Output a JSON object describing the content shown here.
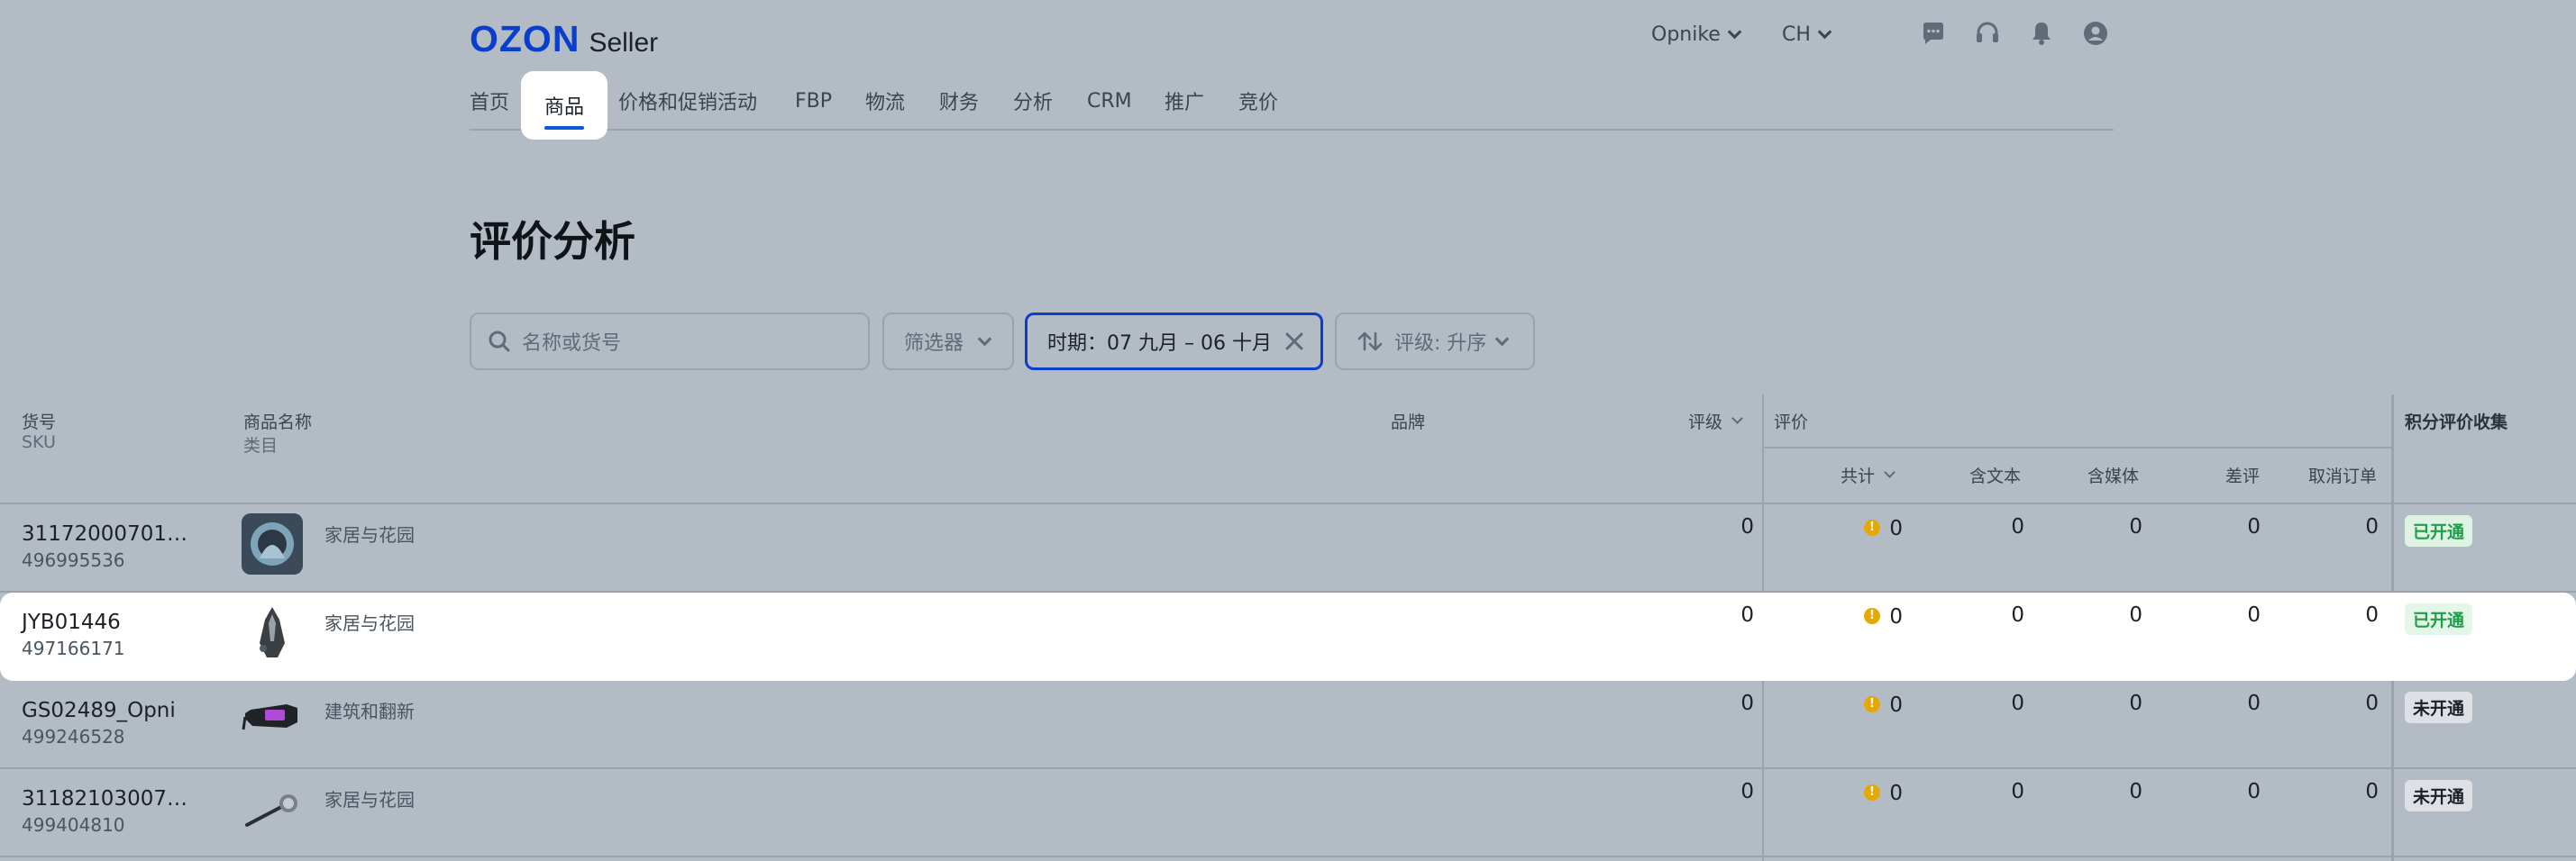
{
  "header": {
    "logo_brand": "OZON",
    "logo_product": "Seller",
    "account": "Opnike",
    "language": "CH",
    "icons": [
      "chat-icon",
      "headset-icon",
      "bell-icon",
      "user-icon"
    ]
  },
  "nav": {
    "items": [
      {
        "label": "首页"
      },
      {
        "label": "商品"
      },
      {
        "label": "价格和促销活动"
      },
      {
        "label": "FBP"
      },
      {
        "label": "物流"
      },
      {
        "label": "财务"
      },
      {
        "label": "分析"
      },
      {
        "label": "CRM"
      },
      {
        "label": "推广"
      },
      {
        "label": "竞价"
      }
    ],
    "active_index": 1
  },
  "page": {
    "title": "评价分析"
  },
  "filters": {
    "search_placeholder": "名称或货号",
    "filter_label": "筛选器",
    "period_label": "时期：07 九月 – 06 十月",
    "sort_label": "评级: 升序"
  },
  "table": {
    "headers": {
      "sku_top": "货号",
      "sku_bottom": "SKU",
      "name_top": "商品名称",
      "name_bottom": "类目",
      "brand": "品牌",
      "rating": "评级",
      "reviews": "评价",
      "total": "共计",
      "with_text": "含文本",
      "with_media": "含媒体",
      "negative": "差评",
      "cancelled": "取消订单",
      "points": "积分评价收集"
    },
    "rows": [
      {
        "article": "31172000701…",
        "sku": "496995536",
        "category": "家居与花园",
        "rating": "0",
        "total": "0",
        "with_text": "0",
        "with_media": "0",
        "negative": "0",
        "cancelled": "0",
        "points_status": "已开通",
        "points_on": true
      },
      {
        "article": "JYB01446",
        "sku": "497166171",
        "category": "家居与花园",
        "rating": "0",
        "total": "0",
        "with_text": "0",
        "with_media": "0",
        "negative": "0",
        "cancelled": "0",
        "points_status": "已开通",
        "points_on": true
      },
      {
        "article": "GS02489_Opni",
        "sku": "499246528",
        "category": "建筑和翻新",
        "rating": "0",
        "total": "0",
        "with_text": "0",
        "with_media": "0",
        "negative": "0",
        "cancelled": "0",
        "points_status": "未开通",
        "points_on": false
      },
      {
        "article": "31182103007…",
        "sku": "499404810",
        "category": "家居与花园",
        "rating": "0",
        "total": "0",
        "with_text": "0",
        "with_media": "0",
        "negative": "0",
        "cancelled": "0",
        "points_status": "未开通",
        "points_on": false
      }
    ],
    "highlighted_row": 1
  },
  "colors": {
    "brand": "#0a3fcb",
    "accent_underline": "#0a5ad8",
    "status_on": "#1e9e47",
    "warning": "#e6a800",
    "overlay_bg": "#b3bcc5"
  }
}
